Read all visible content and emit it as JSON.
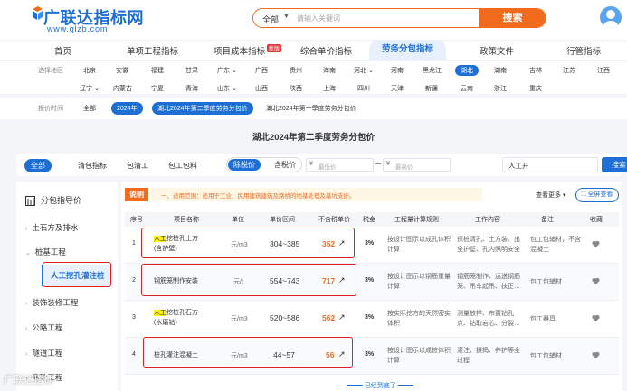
{
  "header": {
    "logo_title": "广联达指标网",
    "logo_url": "www.glzb.com",
    "search": {
      "category": "全部",
      "placeholder": "请输入关键词",
      "button": "搜索"
    }
  },
  "nav": {
    "items": [
      "首页",
      "单项工程指标",
      "项目成本指标",
      "综合单价指标",
      "劳务分包指标",
      "政策文件",
      "行管指标"
    ],
    "new_badge": "新版",
    "active": "劳务分包指标"
  },
  "regions": {
    "label": "选择地区",
    "row1": [
      "北京",
      "安徽",
      "福建",
      "甘肃",
      "广东",
      "广西",
      "贵州",
      "海南",
      "河北",
      "河南",
      "黑龙江",
      "湖北",
      "湖南",
      "吉林",
      "江苏",
      "江西"
    ],
    "row2": [
      "辽宁",
      "内蒙古",
      "宁夏",
      "青海",
      "山东",
      "山西",
      "陕西",
      "上海",
      "四川",
      "天津",
      "新疆",
      "云南",
      "浙江",
      "重庆"
    ],
    "selected": "湖北"
  },
  "period": {
    "label": "报价时间",
    "items": [
      "全部",
      "2024年",
      "湖北2024年第二季度劳务分包价",
      "湖北2024年第一季度劳务分包价"
    ]
  },
  "page_title": "湖北2024年第二季度劳务分包价",
  "filter": {
    "tabs": [
      "全部",
      "清包指标",
      "包清工",
      "包工包料"
    ],
    "tax": {
      "active": "除税价",
      "other": "含税价"
    },
    "min_placeholder": "最低价",
    "max_placeholder": "最高价",
    "currency": "¥",
    "keyword": "人工开",
    "search_button": "搜索"
  },
  "sidebar": {
    "title": "分包指导价",
    "items": [
      "土石方及排水",
      "桩基工程",
      "装饰装修工程",
      "公路工程",
      "隧道工程",
      "商砼工程"
    ],
    "active": "人工挖孔灌注桩"
  },
  "notice": {
    "tag": "说明",
    "text": "一、适用范围：适用于工业、民用建筑建筑及路桥的地基处理及基坑支护。"
  },
  "toolbar": {
    "more": "查看更多 ▾",
    "full_view": "全屏查看"
  },
  "table": {
    "headers": [
      "序号",
      "项目名称",
      "单位",
      "单价区间",
      "不含税单价",
      "税金",
      "工程量计算规则",
      "工作内容",
      "备注",
      "收藏"
    ],
    "rows": [
      {
        "no": "1",
        "name_hl": "人工",
        "name_rest": "挖桩孔土方(含护壁)",
        "unit": "元/m3",
        "range": "304~385",
        "price": "352",
        "tax": "3%",
        "rule": "按设计图示以成孔体积计算",
        "work": "探桩清孔、土方装、出全护壁、孔内照明安全",
        "remark": "包工包辅材，不含混凝土"
      },
      {
        "no": "2",
        "name_hl": "",
        "name_rest": "钢筋笼制作安装",
        "unit": "元/t",
        "range": "554~743",
        "price": "717",
        "tax": "3%",
        "rule": "按设计图示以钢筋重量计算",
        "work": "钢筋笼制作、运送钢筋笼、吊车起吊、扶正…",
        "remark": "包工包辅材"
      },
      {
        "no": "3",
        "name_hl": "人工",
        "name_rest": "挖桩孔石方(水磨钻)",
        "unit": "元/m3",
        "range": "520~586",
        "price": "562",
        "tax": "3%",
        "rule": "按实际挖方的天然密实体积",
        "work": "测量放样、布置钻孔点、钻取岩芯、分裂…",
        "remark": "包工器具"
      },
      {
        "no": "4",
        "name_hl": "",
        "name_rest": "桩孔灌注混凝土",
        "unit": "元/m3",
        "range": "44~57",
        "price": "56",
        "tax": "3%",
        "rule": "按设计图示以成桩体积计算",
        "work": "灌注、振捣、养护等全过程",
        "remark": "包工包辅材"
      }
    ]
  },
  "footer": {
    "loaded": "已经到底了"
  },
  "watermark": "广联达指标"
}
